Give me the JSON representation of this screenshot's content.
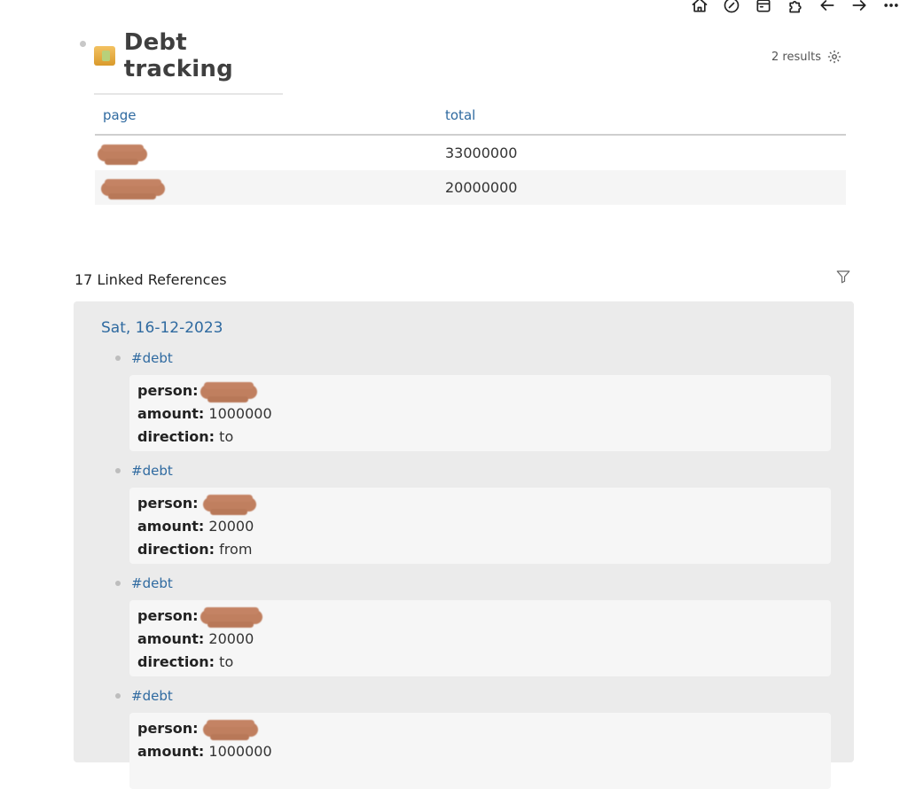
{
  "toolbar": {
    "icons": [
      "home-icon",
      "edit-icon",
      "calendar-icon",
      "puzzle-icon",
      "arrow-left-icon",
      "arrow-right-icon",
      "more-icon"
    ]
  },
  "query": {
    "title": "Debt tracking",
    "results_label": "2 results",
    "columns": [
      "page",
      "total"
    ],
    "rows": [
      {
        "page": "",
        "total": "33000000"
      },
      {
        "page": "",
        "total": "20000000"
      }
    ]
  },
  "linked_refs": {
    "header": "17 Linked References",
    "date": "Sat, 16-12-2023",
    "items": [
      {
        "tag": "#debt",
        "person_label": "person:",
        "amount_label": "amount:",
        "amount": "1000000",
        "direction_label": "direction:",
        "direction": "to"
      },
      {
        "tag": "#debt",
        "person_label": "person:",
        "amount_label": "amount:",
        "amount": "20000",
        "direction_label": "direction:",
        "direction": "from"
      },
      {
        "tag": "#debt",
        "person_label": "person:",
        "amount_label": "amount:",
        "amount": "20000",
        "direction_label": "direction:",
        "direction": "to"
      },
      {
        "tag": "#debt",
        "person_label": "person:",
        "amount_label": "amount:",
        "amount": "1000000",
        "direction_label": "direction:",
        "direction": ""
      }
    ]
  },
  "colors": {
    "link": "#2f6aa0",
    "redaction": "#c07f5f",
    "panel": "#ebebeb"
  }
}
